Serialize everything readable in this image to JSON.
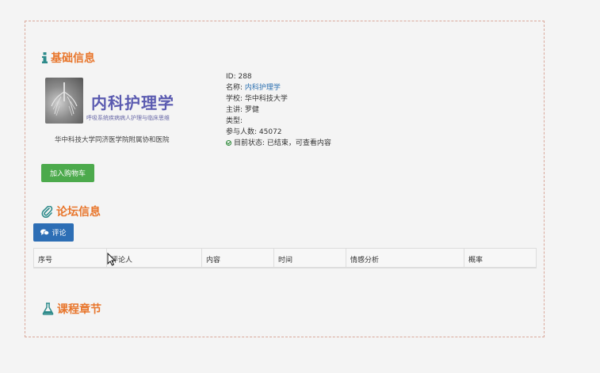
{
  "basic": {
    "title": "基础信息",
    "cover": {
      "title": "内科护理学",
      "subtitle": "呼吸系统疾病病人护理与临床思维",
      "hospital": "华中科技大学同济医学院附属协和医院"
    },
    "info": {
      "id": "ID: 288",
      "name_label": "名称: ",
      "name_value": "内科护理学",
      "school": "学校: 华中科技大学",
      "teacher": "主讲: 罗健",
      "type": "类型:",
      "participants": "参与人数: 45072",
      "status": "目前状态: 已结束，可查看内容"
    },
    "cart_button": "加入购物车"
  },
  "forum": {
    "title": "论坛信息",
    "comment_button": "评论",
    "columns": [
      "序号",
      "评论人",
      "内容",
      "时间",
      "情感分析",
      "概率"
    ]
  },
  "chapters": {
    "title": "课程章节"
  },
  "colors": {
    "accent": "#e8762c",
    "link": "#2a6fb0",
    "success": "#4caa4c",
    "primary": "#2d6eb5"
  },
  "icons": {
    "basic": "info-icon",
    "forum": "paperclip-icon",
    "chapters": "flask-icon",
    "comment": "comments-icon",
    "status": "check-circle-icon"
  }
}
